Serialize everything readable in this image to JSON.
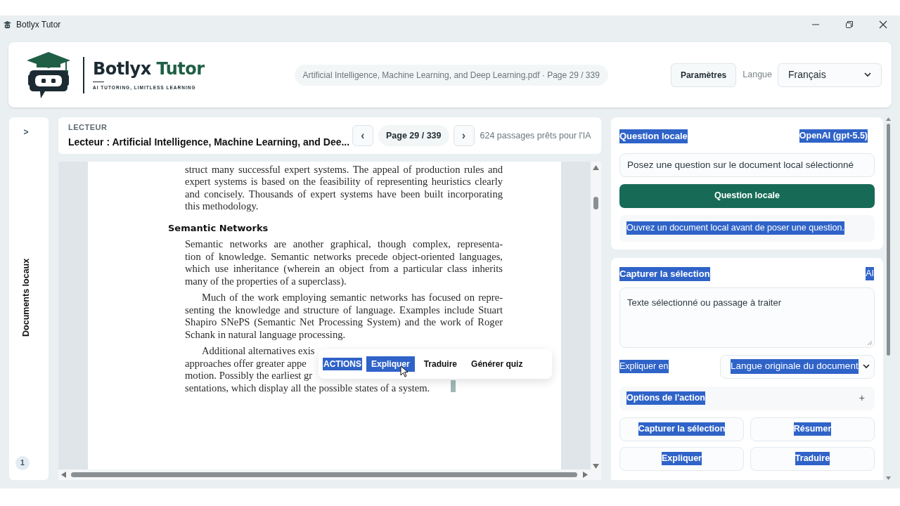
{
  "window": {
    "title": "Botlyx Tutor"
  },
  "header": {
    "brand": "Botlyx",
    "brand_accent": "Tutor",
    "tagline": "AI TUTORING, LIMITLESS LEARNING",
    "document_chip": "Artificial Intelligence, Machine Learning, and Deep Learning.pdf · Page 29 / 339",
    "settings_button": "Paramètres",
    "language_label": "Langue",
    "language_value": "Français"
  },
  "sidebar": {
    "toggle": ">",
    "title": "Documents locaux",
    "count": "1"
  },
  "reader": {
    "eyebrow": "LECTEUR",
    "title": "Lecteur : Artificial Intelligence, Machine Learning, and Dee...",
    "prev": "‹",
    "page": "Page 29 / 339",
    "next": "›",
    "passages": "624 passages prêts pour l'IA"
  },
  "page_blocks": [
    {
      "kind": "paragraph",
      "indent": false,
      "covered": false,
      "lines": [
        "struct many successful expert systems. The appeal of production rules and",
        "expert systems is based on the feasibility of representing heuristics clearly",
        "and concisely. Thousands of expert systems have been built incorporating",
        "this methodology."
      ]
    },
    {
      "kind": "heading",
      "text": "Semantic Networks"
    },
    {
      "kind": "paragraph",
      "indent": false,
      "covered": false,
      "lines": [
        "Semantic networks are another graphical, though complex, representa-",
        "tion of knowledge. Semantic networks precede object-oriented languages,",
        "which use inheritance (wherein an object from a particular class inherits",
        "many of the properties of a superclass)."
      ]
    },
    {
      "kind": "paragraph",
      "indent": true,
      "covered": false,
      "lines": [
        "Much of the work employing semantic networks has focused on repre-",
        "senting the knowledge and structure of language. Examples include Stuart",
        "Shapiro SNePS (Semantic Net Processing System) and the work of Roger",
        "Schank in natural language processing."
      ]
    },
    {
      "kind": "paragraph",
      "indent": true,
      "covered": true,
      "lines": [
        "Additional alternatives exis",
        "approaches offer greater appe",
        "motion. Possibly the earliest gr",
        "sentations, which display all the possible states of a system."
      ]
    }
  ],
  "selection_popup": {
    "items": [
      {
        "label": "ACTIONS",
        "kind": "heading",
        "highlighted": true
      },
      {
        "label": "Expliquer",
        "kind": "action",
        "highlighted": true
      },
      {
        "label": "Traduire",
        "kind": "action",
        "highlighted": false
      },
      {
        "label": "Générer quiz",
        "kind": "action",
        "highlighted": false
      }
    ]
  },
  "assistant": {
    "selection_highlight": true,
    "question_card": {
      "title": "Question locale",
      "provider": "OpenAI (gpt-5.5)",
      "input_placeholder": "Posez une question sur le document local sélectionné",
      "submit": "Question locale",
      "notice": "Ouvrez un document local avant de poser une question."
    },
    "capture_card": {
      "title": "Capturer la sélection",
      "badge": "AI",
      "textarea_placeholder": "Texte sélectionné ou passage à traiter",
      "explain_label": "Expliquer en",
      "explain_value": "Langue originale du document",
      "options_label": "Options de l'action",
      "options_toggle": "+",
      "actions": [
        "Capturer la sélection",
        "Résumer",
        "Expliquer",
        "Traduire"
      ]
    }
  }
}
